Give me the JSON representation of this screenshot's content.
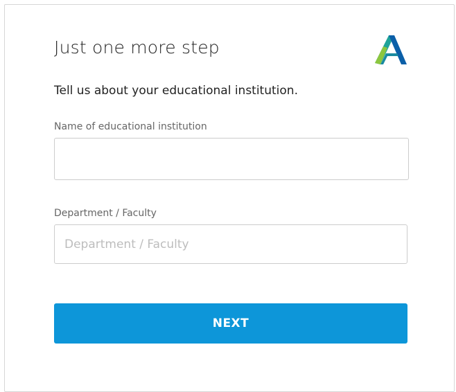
{
  "header": {
    "title": "Just one more step",
    "logo_icon": "autodesk-logo-icon"
  },
  "intro": {
    "text": "Tell us about your educational institution."
  },
  "form": {
    "institution": {
      "label": "Name of educational institution",
      "value": "",
      "placeholder": ""
    },
    "department": {
      "label": "Department / Faculty",
      "value": "",
      "placeholder": "Department / Faculty"
    },
    "next_label": "NEXT"
  },
  "colors": {
    "button": "#0d96d9",
    "logo_teal": "#1fa39a",
    "logo_green": "#8cc63f",
    "logo_blue": "#0a5fa8"
  }
}
